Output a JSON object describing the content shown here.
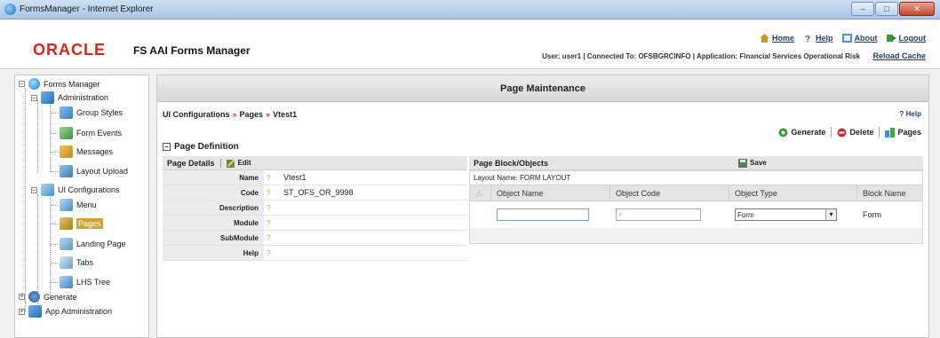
{
  "window": {
    "title": "FormsManager - Internet Explorer",
    "min": "–",
    "max": "□",
    "close": "✕"
  },
  "header": {
    "brand": "ORACLE",
    "product": "FS AAI Forms Manager",
    "links": {
      "home": "Home",
      "help": "Help",
      "about": "About",
      "logout": "Logout"
    },
    "user_info": "User: user1 | Connected To: OFSBGRCINFO | Application: Financial Services Operational Risk",
    "reload": "Reload Cache"
  },
  "tree": {
    "root": "Forms Manager",
    "administration": "Administration",
    "admin_children": [
      "Group Styles",
      "Form Events",
      "Messages",
      "Layout Upload"
    ],
    "ui_configurations": "UI Configurations",
    "ui_children": [
      "Menu",
      "Pages",
      "Landing Page",
      "Tabs",
      "LHS Tree"
    ],
    "generate": "Generate",
    "app_admin": "App Administration",
    "selected": "Pages"
  },
  "main": {
    "title": "Page Maintenance",
    "breadcrumb": [
      "UI Configurations",
      "Pages",
      "Vtest1"
    ],
    "breadcrumb_sep": "»",
    "help": "? Help",
    "actions": {
      "generate": "Generate",
      "delete": "Delete",
      "pages": "Pages"
    },
    "page_definition": "Page Definition",
    "page_details_label": "Page Details",
    "edit_label": "Edit",
    "details": [
      {
        "label": "Name",
        "value": "Vtest1"
      },
      {
        "label": "Code",
        "value": "ST_OFS_OR_9998"
      },
      {
        "label": "Description",
        "value": ""
      },
      {
        "label": "Module",
        "value": ""
      },
      {
        "label": "SubModule",
        "value": ""
      },
      {
        "label": "Help",
        "value": ""
      }
    ],
    "objects_label": "Page Block/Objects",
    "save_label": "Save",
    "layout_name": "Layout Name: FORM LAYOUT",
    "columns": [
      "Object Name",
      "Object Code",
      "Object Type",
      "Block Name"
    ],
    "row": {
      "object_name": "",
      "object_code": "",
      "object_type": "Form",
      "block_name": "Form"
    }
  }
}
